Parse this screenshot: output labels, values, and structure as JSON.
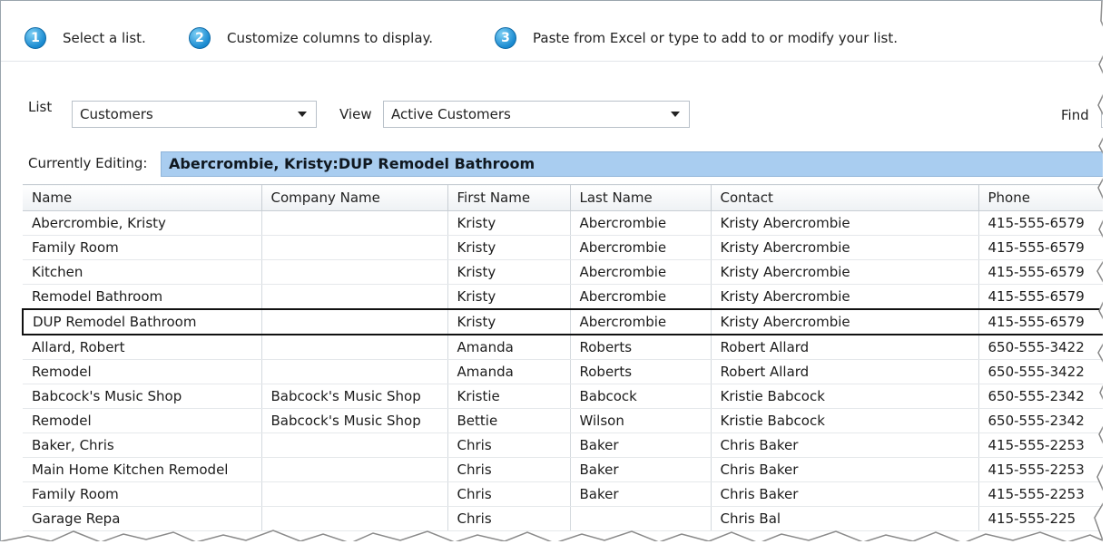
{
  "steps": [
    {
      "number": "1",
      "text": "Select a list."
    },
    {
      "number": "2",
      "text": "Customize columns to display."
    },
    {
      "number": "3",
      "text": "Paste from Excel or type to add to or modify your list."
    }
  ],
  "controls": {
    "list_label": "List",
    "list_value": "Customers",
    "view_label": "View",
    "view_value": "Active Customers",
    "find_label": "Find"
  },
  "editing": {
    "label": "Currently Editing:",
    "value": "Abercrombie, Kristy:DUP Remodel Bathroom"
  },
  "table": {
    "columns": [
      "Name",
      "Company Name",
      "First Name",
      "Last Name",
      "Contact",
      "Phone"
    ],
    "rows": [
      [
        "Abercrombie, Kristy",
        "",
        "Kristy",
        "Abercrombie",
        "Kristy Abercrombie",
        "415-555-6579"
      ],
      [
        "Family Room",
        "",
        "Kristy",
        "Abercrombie",
        "Kristy Abercrombie",
        "415-555-6579"
      ],
      [
        "Kitchen",
        "",
        "Kristy",
        "Abercrombie",
        "Kristy Abercrombie",
        "415-555-6579"
      ],
      [
        "Remodel Bathroom",
        "",
        "Kristy",
        "Abercrombie",
        "Kristy Abercrombie",
        "415-555-6579"
      ],
      [
        "DUP Remodel Bathroom",
        "",
        "Kristy",
        "Abercrombie",
        "Kristy Abercrombie",
        "415-555-6579"
      ],
      [
        "Allard, Robert",
        "",
        "Amanda",
        "Roberts",
        "Robert Allard",
        "650-555-3422"
      ],
      [
        "Remodel",
        "",
        "Amanda",
        "Roberts",
        "Robert Allard",
        "650-555-3422"
      ],
      [
        "Babcock's Music Shop",
        "Babcock's Music Shop",
        "Kristie",
        "Babcock",
        "Kristie Babcock",
        "650-555-2342"
      ],
      [
        "Remodel",
        "Babcock's Music Shop",
        "Bettie",
        "Wilson",
        "Kristie Babcock",
        "650-555-2342"
      ],
      [
        "Baker, Chris",
        "",
        "Chris",
        "Baker",
        "Chris Baker",
        "415-555-2253"
      ],
      [
        "Main Home Kitchen Remodel",
        "",
        "Chris",
        "Baker",
        "Chris Baker",
        "415-555-2253"
      ],
      [
        "Family Room",
        "",
        "Chris",
        "Baker",
        "Chris Baker",
        "415-555-2253"
      ],
      [
        "Garage Repa",
        "",
        "Chris",
        "",
        "Chris Bal",
        "415-555-225"
      ]
    ],
    "selected_row": 4
  },
  "colors": {
    "accent": "#1a8ad0",
    "editing_bar": "#a9cdf0"
  }
}
